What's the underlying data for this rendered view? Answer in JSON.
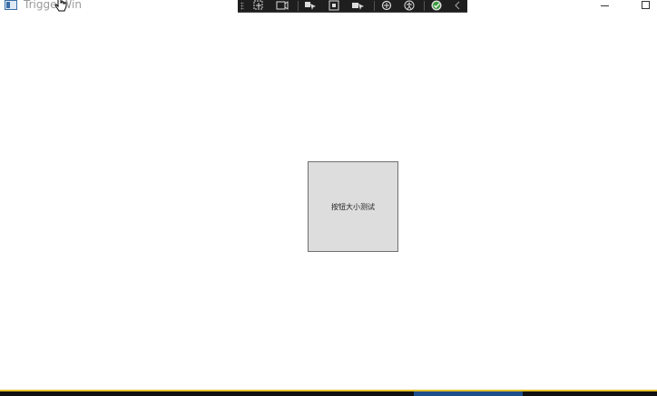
{
  "window": {
    "title": "TriggerWin"
  },
  "devtools": {
    "icons": [
      "select-element-icon",
      "display-layout-adorners-icon",
      "track-focus-icon",
      "preview-selection-icon",
      "binding-failures-icon",
      "hot-reload-icon",
      "accessibility-icon",
      "verified-icon",
      "collapse-icon"
    ]
  },
  "main": {
    "test_button_label": "按钮大小测试"
  },
  "colors": {
    "button_background": "#dddddd",
    "button_border": "#707070",
    "devtools_background": "#1e1e1e",
    "taskbar_accent": "#e6c229"
  }
}
